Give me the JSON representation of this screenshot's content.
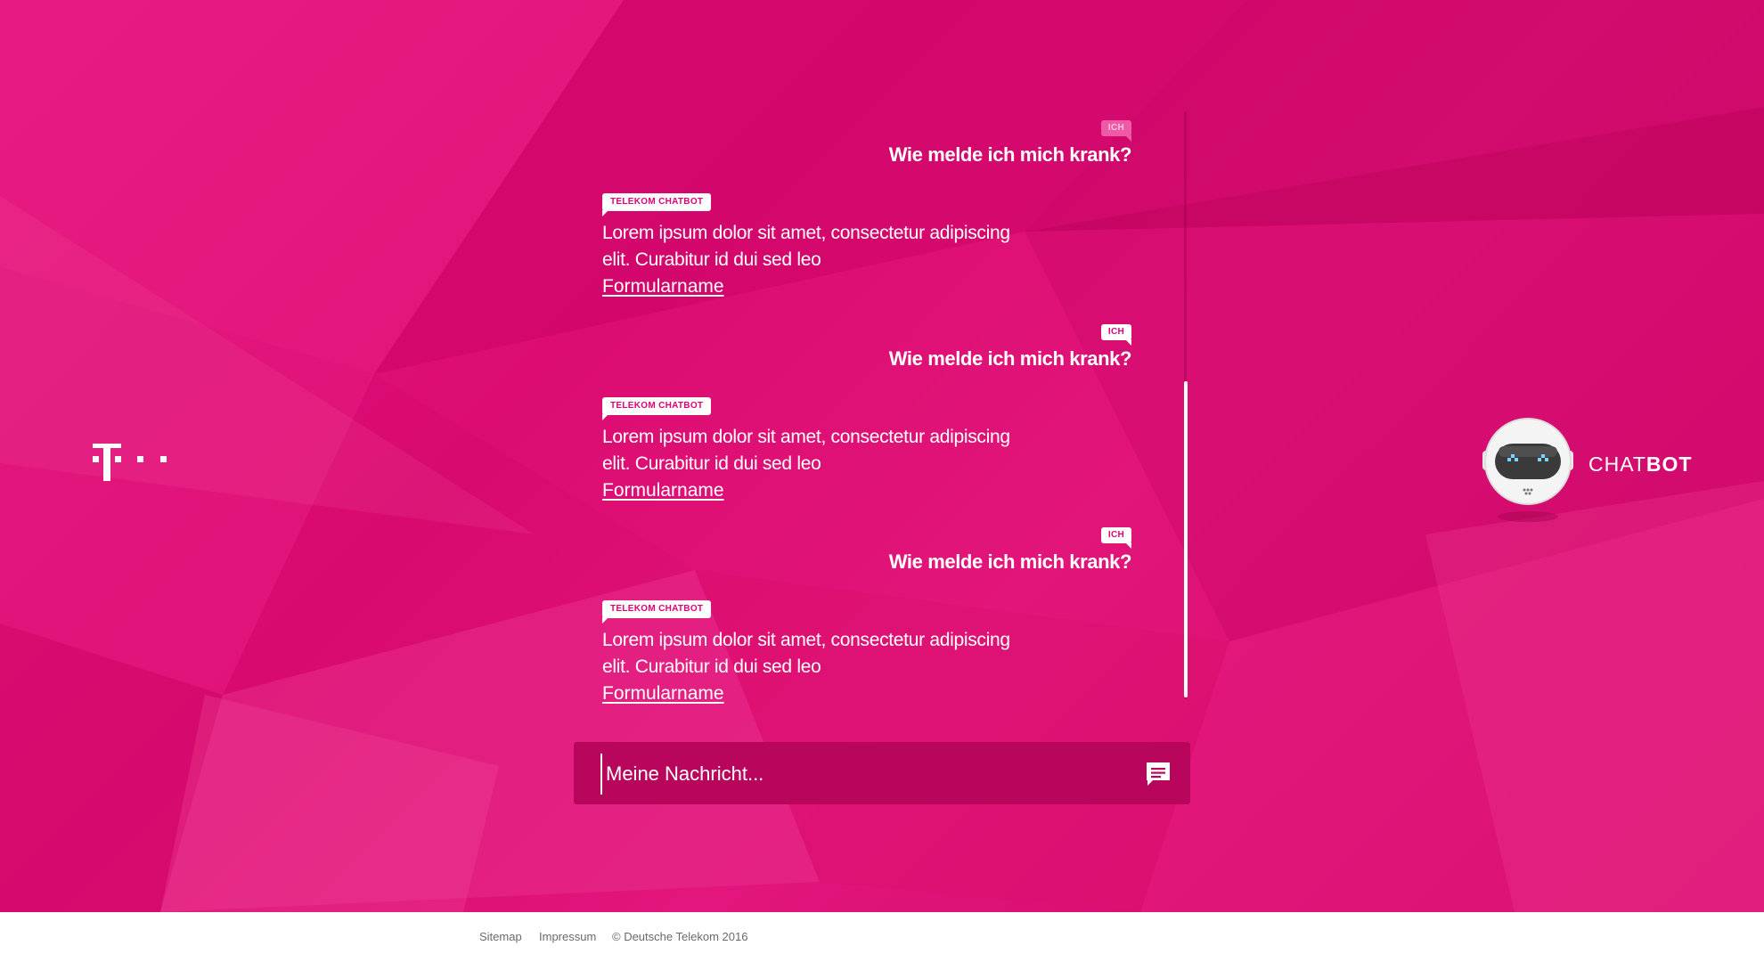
{
  "brand": {
    "primary_color": "#e20074",
    "chatbot_label_light": "CHAT",
    "chatbot_label_bold": "BOT"
  },
  "conversation": [
    {
      "sender_tag": "ICH",
      "text": "Wie melde ich mich krank?",
      "faded": true
    },
    {
      "sender_tag": "TELEKOM CHATBOT",
      "text": "Lorem ipsum dolor sit amet, consectetur adipiscing elit. Curabitur id dui sed leo",
      "link": "Formularname"
    },
    {
      "sender_tag": "ICH",
      "text": "Wie melde ich mich krank?",
      "faded": false
    },
    {
      "sender_tag": "TELEKOM CHATBOT",
      "text": "Lorem ipsum dolor sit amet, consectetur adipiscing elit. Curabitur id dui sed leo",
      "link": "Formularname"
    },
    {
      "sender_tag": "ICH",
      "text": "Wie melde ich mich krank?",
      "faded": false
    },
    {
      "sender_tag": "TELEKOM CHATBOT",
      "text": "Lorem ipsum dolor sit amet, consectetur adipiscing elit. Curabitur id dui sed leo",
      "link": "Formularname"
    }
  ],
  "input": {
    "placeholder": "Meine Nachricht...",
    "value": "",
    "send_icon": "chat-bubble-icon"
  },
  "footer": {
    "links": [
      "Sitemap",
      "Impressum"
    ],
    "copyright": "© Deutsche Telekom 2016"
  }
}
